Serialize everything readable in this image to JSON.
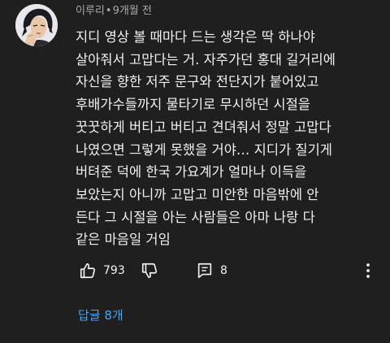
{
  "comment": {
    "author": "이루리",
    "separator": "•",
    "time": "9개월 전",
    "lines": [
      "지디 영상 볼 때마다 드는 생각은 딱 하나야",
      "살아줘서 고맙다는 거. 자주가던 홍대 길거리에",
      "자신을 향한 저주 문구와 전단지가 붙어있고",
      "후배가수들까지 물타기로 무시하던 시절을",
      "꿋꿋하게 버티고 버티고 견뎌줘서 정말 고맙다",
      "나였으면 그렇게 못했을 거야… 지디가 질기게",
      "버텨준 덕에 한국 가요계가 얼마나 이득을",
      "보았는지 아니까 고맙고 미안한 마음밖에 안",
      "든다 그 시절을 아는 사람들은 아마 나랑 다",
      "같은 마음일 거임"
    ],
    "likes": "793",
    "reply_count": "8",
    "replies_label": "답글 8개"
  },
  "colors": {
    "background": "#1f1f1f",
    "text": "#f1f1f1",
    "meta": "#aaaaaa",
    "link": "#3ea6ff"
  },
  "icons": {
    "like": "thumbs-up-icon",
    "dislike": "thumbs-down-icon",
    "reply": "comment-icon",
    "more": "vertical-dots-icon"
  }
}
